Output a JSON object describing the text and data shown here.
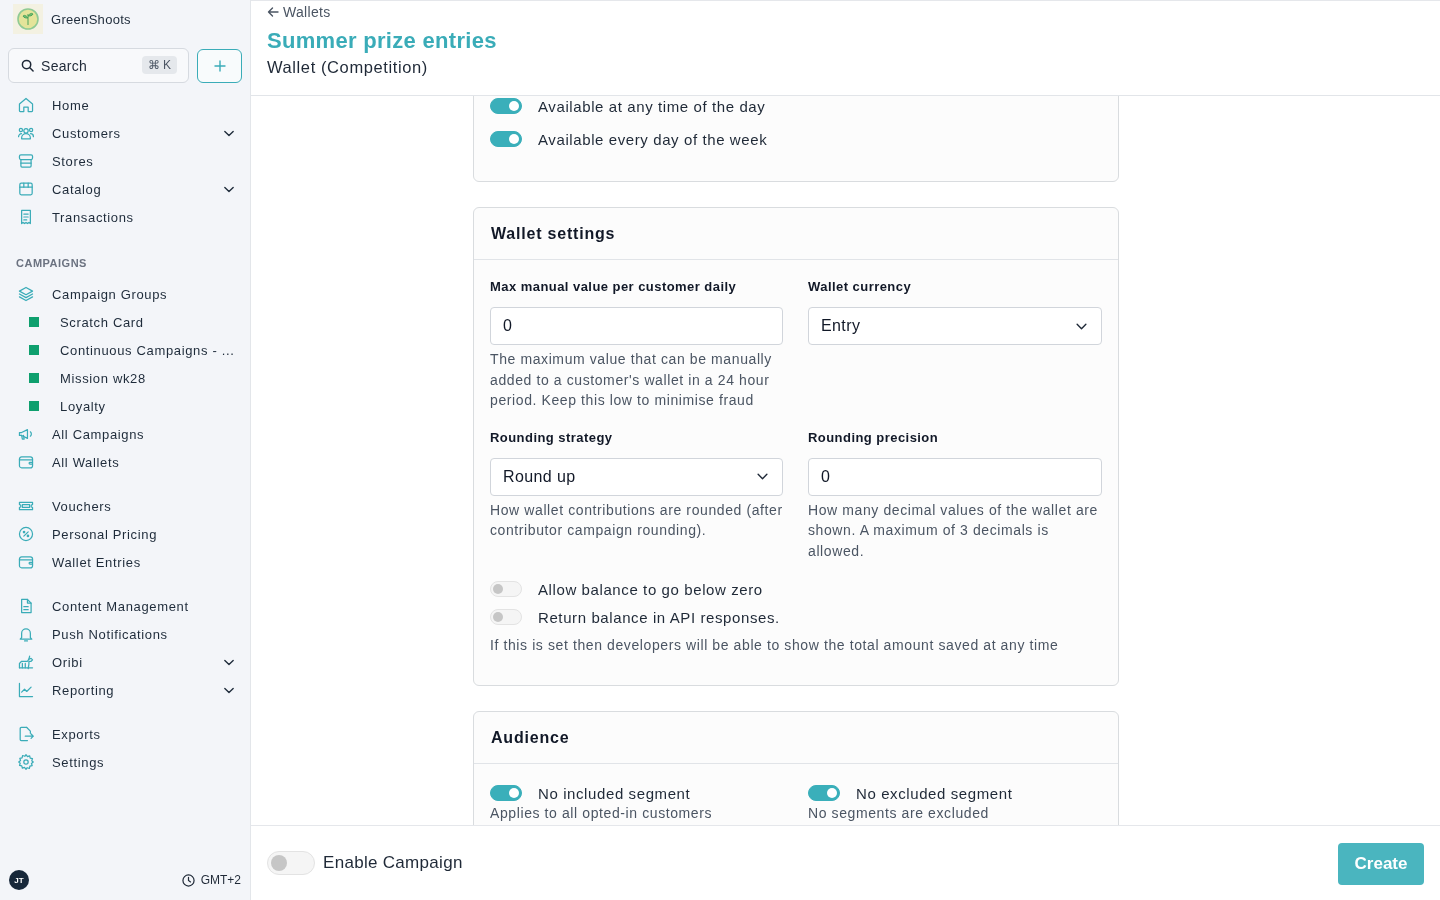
{
  "sidebar": {
    "brand": "GreenShoots",
    "search": {
      "placeholder": "Search",
      "shortcut": "⌘ K"
    },
    "groups": [
      {
        "items": [
          {
            "label": "Home",
            "kind": "link"
          },
          {
            "label": "Customers",
            "kind": "group"
          },
          {
            "label": "Stores",
            "kind": "link"
          },
          {
            "label": "Catalog",
            "kind": "group"
          },
          {
            "label": "Transactions",
            "kind": "link"
          }
        ]
      },
      {
        "heading": "CAMPAIGNS",
        "items": [
          {
            "label": "Campaign Groups",
            "kind": "link",
            "children": [
              {
                "label": "Scratch Card",
                "color": "#0e9f6e"
              },
              {
                "label": "Continuous Campaigns - ...",
                "color": "#0e9f6e"
              },
              {
                "label": "Mission wk28",
                "color": "#0e9f6e"
              },
              {
                "label": "Loyalty",
                "color": "#0e9f6e"
              }
            ]
          },
          {
            "label": "All Campaigns",
            "kind": "link"
          },
          {
            "label": "All Wallets",
            "kind": "link"
          }
        ]
      },
      {
        "items": [
          {
            "label": "Vouchers",
            "kind": "link"
          },
          {
            "label": "Personal Pricing",
            "kind": "link"
          },
          {
            "label": "Wallet Entries",
            "kind": "link"
          }
        ]
      },
      {
        "items": [
          {
            "label": "Content Management",
            "kind": "link"
          },
          {
            "label": "Push Notifications",
            "kind": "link"
          },
          {
            "label": "Oribi",
            "kind": "group"
          },
          {
            "label": "Reporting",
            "kind": "group"
          }
        ]
      },
      {
        "items": [
          {
            "label": "Exports",
            "kind": "link"
          },
          {
            "label": "Settings",
            "kind": "link"
          }
        ]
      }
    ],
    "user": {
      "initials": "JT"
    },
    "timezone": "GMT+2"
  },
  "header": {
    "back_link": "Wallets",
    "title": "Summer prize entries",
    "subtitle": "Wallet (Competition)"
  },
  "sections": [
    {
      "kind": "toggle_list",
      "toggles": [
        {
          "label": "Available at any time of the day",
          "on": true
        },
        {
          "label": "Available every day of the week",
          "on": true
        }
      ]
    },
    {
      "kind": "form",
      "title": "Wallet settings",
      "fields": [
        {
          "kind": "input",
          "label": "Max manual value per customer daily",
          "value": "0",
          "help": "The maximum value that can be manually added to a customer's wallet in a 24 hour period. Keep this low to minimise fraud"
        },
        {
          "kind": "select",
          "label": "Wallet currency",
          "value": "Entry"
        },
        {
          "kind": "select",
          "label": "Rounding strategy",
          "value": "Round up",
          "help": "How wallet contributions are rounded (after contributor campaign rounding)."
        },
        {
          "kind": "input",
          "label": "Rounding precision",
          "value": "0",
          "help": "How many decimal values of the wallet are shown. A maximum of 3 decimals is allowed."
        }
      ],
      "toggles": [
        {
          "label": "Allow balance to go below zero",
          "on": false
        },
        {
          "label": "Return balance in API responses.",
          "on": false
        }
      ],
      "note": "If this is set then developers will be able to show the total amount saved at any time"
    },
    {
      "kind": "toggle_grid",
      "title": "Audience",
      "toggles": [
        {
          "label": "No included segment",
          "on": true,
          "help": "Applies to all opted-in customers"
        },
        {
          "label": "No excluded segment",
          "on": true,
          "help": "No segments are excluded"
        }
      ]
    }
  ],
  "footer": {
    "enable_campaign": {
      "label": "Enable Campaign",
      "on": false
    },
    "create_button": "Create"
  }
}
